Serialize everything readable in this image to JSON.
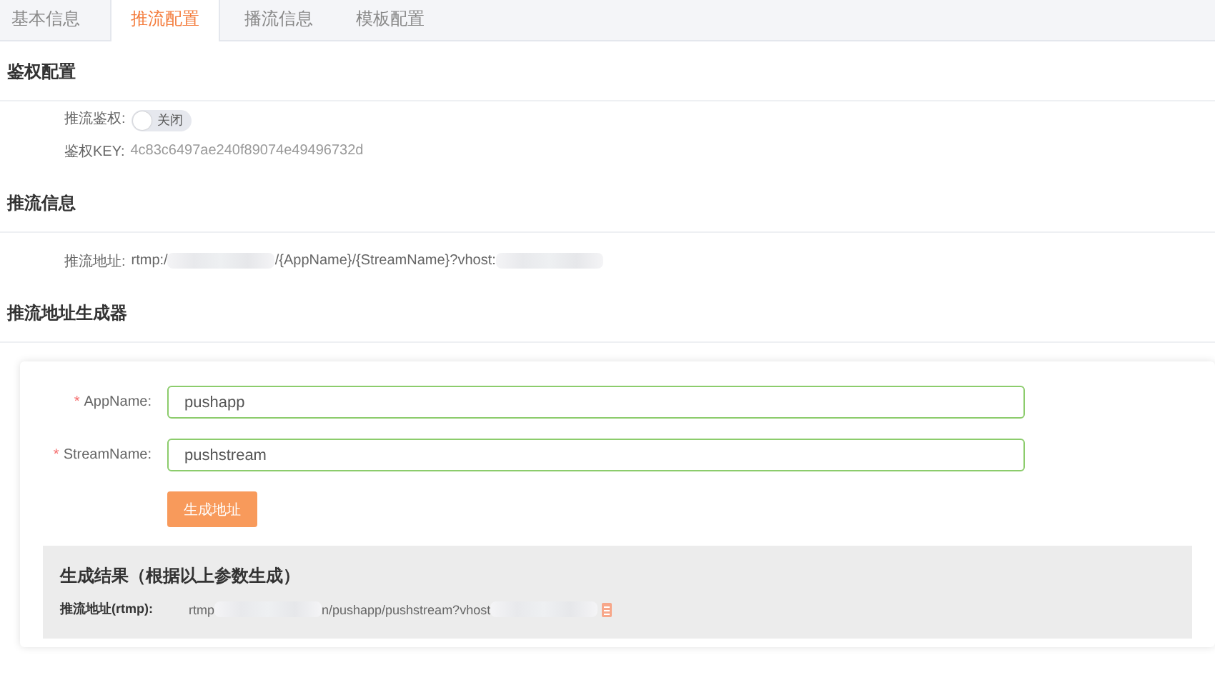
{
  "tabs": [
    {
      "label": "基本信息",
      "selected": false
    },
    {
      "label": "推流配置",
      "selected": true
    },
    {
      "label": "播流信息",
      "selected": false
    },
    {
      "label": "模板配置",
      "selected": false
    }
  ],
  "auth": {
    "title": "鉴权配置",
    "toggle_label": "推流鉴权:",
    "toggle": {
      "on": false,
      "text": "关闭"
    },
    "key_label": "鉴权KEY:",
    "key_value": "4c83c6497ae240f89074e49496732d"
  },
  "push_info": {
    "title": "推流信息",
    "address_label": "推流地址:",
    "address_parts": [
      {
        "kind": "text",
        "text": "rtmp:/"
      },
      {
        "kind": "redacted"
      },
      {
        "kind": "text",
        "text": "/{AppName}/{StreamName}?vhost:"
      },
      {
        "kind": "redacted"
      }
    ]
  },
  "generator": {
    "title": "推流地址生成器",
    "fields": [
      {
        "required_mark": "*",
        "label": "AppName:",
        "value": "pushapp"
      },
      {
        "required_mark": "*",
        "label": "StreamName:",
        "value": "pushstream"
      }
    ],
    "button": "生成地址",
    "result": {
      "title": "生成结果（根据以上参数生成）",
      "label": "推流地址(rtmp):",
      "parts": [
        {
          "kind": "text",
          "text": "rtmp"
        },
        {
          "kind": "redacted"
        },
        {
          "kind": "text",
          "text": "n/pushapp/pushstream?vhost"
        },
        {
          "kind": "redacted"
        }
      ]
    }
  }
}
